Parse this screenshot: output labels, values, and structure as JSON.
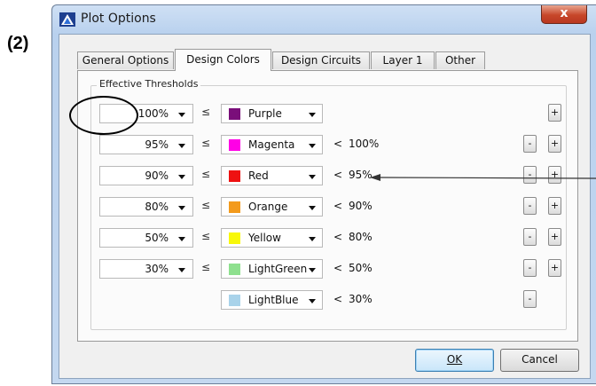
{
  "step_label": "(2)",
  "window": {
    "title": "Plot Options",
    "close_symbol": "x"
  },
  "tabs": [
    {
      "label": "General Options",
      "active": false
    },
    {
      "label": "Design Colors",
      "active": true
    },
    {
      "label": "Design Circuits",
      "active": false
    },
    {
      "label": "Layer 1",
      "active": false
    },
    {
      "label": "Other",
      "active": false
    }
  ],
  "group": {
    "label": "Effective Thresholds"
  },
  "le_symbol": "≤",
  "lt_symbol": "<",
  "rows": [
    {
      "threshold": "100%",
      "color_name": "Purple",
      "swatch": "#7a0e7a",
      "upper": "",
      "minus": false,
      "plus": true
    },
    {
      "threshold": "95%",
      "color_name": "Magenta",
      "swatch": "#ff00e6",
      "upper": "100%",
      "minus": true,
      "plus": true
    },
    {
      "threshold": "90%",
      "color_name": "Red",
      "swatch": "#ee1111",
      "upper": "95%",
      "minus": true,
      "plus": true
    },
    {
      "threshold": "80%",
      "color_name": "Orange",
      "swatch": "#f39a1c",
      "upper": "90%",
      "minus": true,
      "plus": true
    },
    {
      "threshold": "50%",
      "color_name": "Yellow",
      "swatch": "#f8f80a",
      "upper": "80%",
      "minus": true,
      "plus": true
    },
    {
      "threshold": "30%",
      "color_name": "LightGreen",
      "swatch": "#8ee08e",
      "upper": "50%",
      "minus": true,
      "plus": true
    },
    {
      "threshold": "",
      "color_name": "LightBlue",
      "swatch": "#a9d3ea",
      "upper": "30%",
      "minus": true,
      "plus": false
    }
  ],
  "buttons": {
    "minus_label": "-",
    "plus_label": "+",
    "ok": "OK",
    "cancel": "Cancel"
  },
  "colors": {
    "accent": "#3c7fb1",
    "title_bar": "#b9d1ee",
    "close": "#c7472a"
  }
}
